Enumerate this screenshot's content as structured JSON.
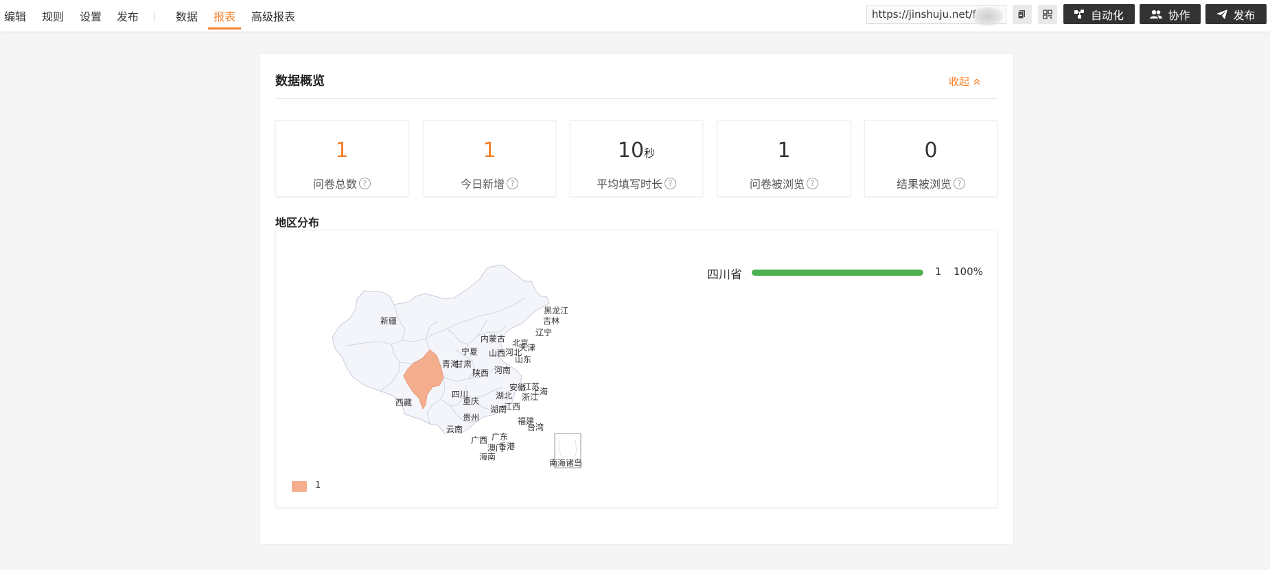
{
  "nav": {
    "items": [
      "编辑",
      "规则",
      "设置",
      "发布",
      "数据",
      "报表",
      "高级报表"
    ],
    "active": "报表"
  },
  "toolbar": {
    "url": "https://jinshuju.net/f/",
    "automation_label": "自动化",
    "collab_label": "协作",
    "publish_label": "发布"
  },
  "overview": {
    "title": "数据概览",
    "collapse_label": "收起"
  },
  "stats": [
    {
      "value": "1",
      "unit": "",
      "label": "问卷总数",
      "color": "#f5812a"
    },
    {
      "value": "1",
      "unit": "",
      "label": "今日新增",
      "color": "#f5812a"
    },
    {
      "value": "10",
      "unit": "秒",
      "label": "平均填写时长",
      "color": "#333333"
    },
    {
      "value": "1",
      "unit": "",
      "label": "问卷被浏览",
      "color": "#333333"
    },
    {
      "value": "0",
      "unit": "",
      "label": "结果被浏览",
      "color": "#333333"
    }
  ],
  "region": {
    "title": "地区分布",
    "map_labels": [
      "新疆",
      "西藏",
      "青海",
      "甘肃",
      "宁夏",
      "内蒙古",
      "黑龙江",
      "吉林",
      "辽宁",
      "北京",
      "天津",
      "河北",
      "山西",
      "山东",
      "陕西",
      "河南",
      "四川",
      "重庆",
      "湖北",
      "安徽",
      "江苏",
      "上海",
      "浙江",
      "湖南",
      "江西",
      "贵州",
      "云南",
      "广西",
      "广东",
      "福建",
      "台湾",
      "澳门",
      "香港",
      "海南",
      "南海诸岛"
    ],
    "highlighted_province": "四川",
    "highlight_color": "#f4ae8e",
    "legend_value": "1",
    "ranking": [
      {
        "province": "四川省",
        "count": "1",
        "percent": "100%",
        "fraction": 1.0,
        "color": "#4caf50"
      }
    ]
  }
}
